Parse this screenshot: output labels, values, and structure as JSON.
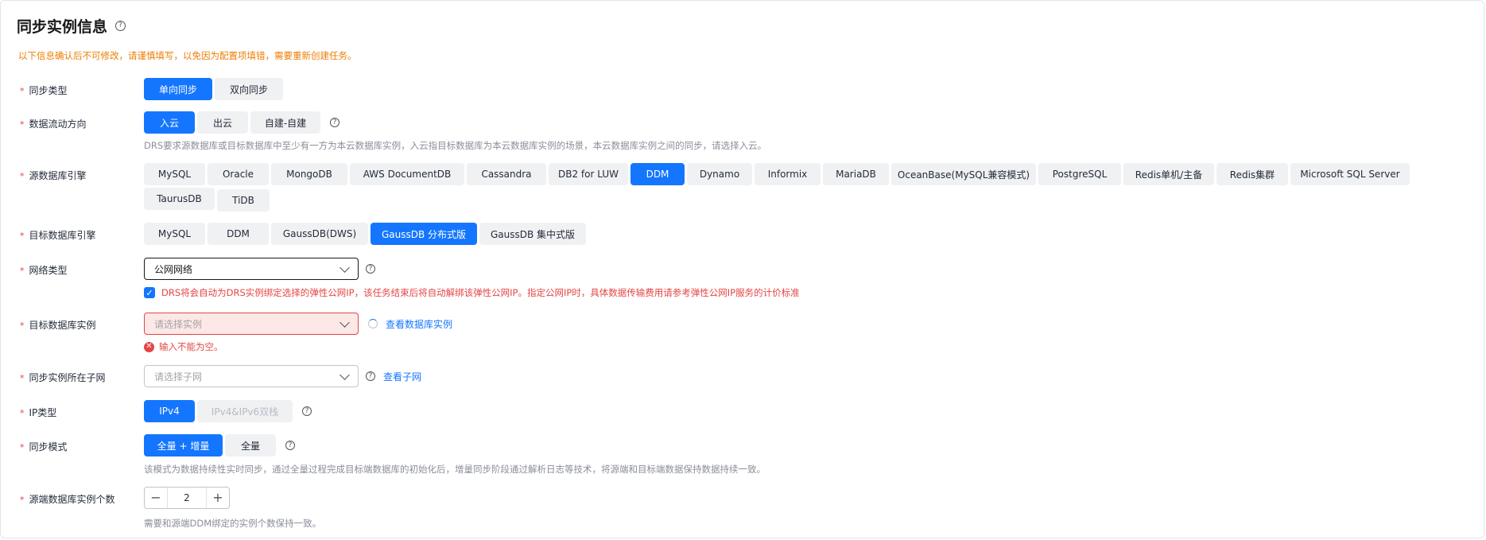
{
  "page": {
    "title": "同步实例信息",
    "notice": "以下信息确认后不可修改，请谨慎填写，以免因为配置项填错，需要重新创建任务。"
  },
  "sync_type": {
    "label": "同步类型",
    "options": [
      "单向同步",
      "双向同步"
    ],
    "selected": "单向同步"
  },
  "flow_direction": {
    "label": "数据流动方向",
    "options": [
      "入云",
      "出云",
      "自建-自建"
    ],
    "selected": "入云",
    "hint": "DRS要求源数据库或目标数据库中至少有一方为本云数据库实例，入云指目标数据库为本云数据库实例的场景，本云数据库实例之间的同步，请选择入云。"
  },
  "source_engine": {
    "label": "源数据库引擎",
    "options": [
      "MySQL",
      "Oracle",
      "MongoDB",
      "AWS DocumentDB",
      "Cassandra",
      "DB2 for LUW",
      "DDM",
      "Dynamo",
      "Informix",
      "MariaDB",
      "OceanBase(MySQL兼容模式)",
      "PostgreSQL",
      "Redis单机/主备",
      "Redis集群",
      "Microsoft SQL Server",
      "TaurusDB",
      "TiDB"
    ],
    "selected": "DDM"
  },
  "target_engine": {
    "label": "目标数据库引擎",
    "options": [
      "MySQL",
      "DDM",
      "GaussDB(DWS)",
      "GaussDB 分布式版",
      "GaussDB 集中式版"
    ],
    "selected": "GaussDB 分布式版"
  },
  "network_type": {
    "label": "网络类型",
    "value": "公网网络",
    "checkbox_text": "DRS将会自动为DRS实例绑定选择的弹性公网IP，该任务结束后将自动解绑该弹性公网IP。指定公网IP时，具体数据传输费用请参考弹性公网IP服务的计价标准"
  },
  "target_instance": {
    "label": "目标数据库实例",
    "placeholder": "请选择实例",
    "link": "查看数据库实例",
    "error": "输入不能为空。"
  },
  "subnet": {
    "label": "同步实例所在子网",
    "placeholder": "请选择子网",
    "link": "查看子网"
  },
  "ip_type": {
    "label": "IP类型",
    "options": [
      "IPv4",
      "IPv4&IPv6双栈"
    ],
    "selected": "IPv4"
  },
  "sync_mode": {
    "label": "同步模式",
    "options": [
      "全量 + 增量",
      "全量"
    ],
    "selected": "全量 + 增量",
    "hint": "该模式为数据持续性实时同步，通过全量过程完成目标端数据库的初始化后，增量同步阶段通过解析日志等技术，将源端和目标端数据保持数据持续一致。"
  },
  "logic_count": {
    "label": "源端数据库实例个数",
    "value": "2",
    "hint": "需要和源端DDM绑定的实例个数保持一致。"
  },
  "colors": {
    "primary": "#1476ff",
    "danger": "#e54545",
    "warning": "#ed7d02"
  }
}
